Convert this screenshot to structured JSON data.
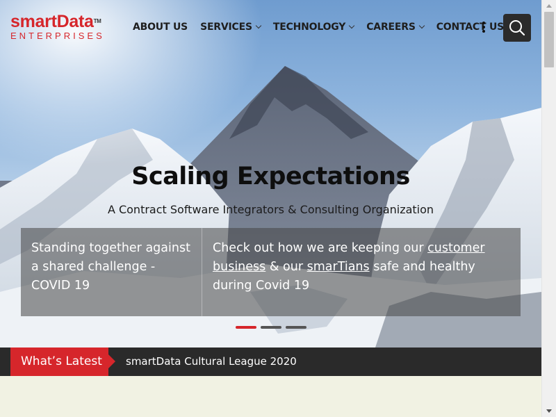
{
  "header": {
    "logo": {
      "main": "smartData",
      "tm": "TM",
      "sub": "ENTERPRISES"
    },
    "nav": [
      {
        "label": "ABOUT US",
        "dropdown": false
      },
      {
        "label": "SERVICES",
        "dropdown": true
      },
      {
        "label": "TECHNOLOGY",
        "dropdown": true
      },
      {
        "label": "CAREERS",
        "dropdown": true
      },
      {
        "label": "CONTACT US",
        "dropdown": false
      }
    ],
    "menu_icon": "kebab-menu-icon",
    "search_icon": "search-icon"
  },
  "hero": {
    "title": "Scaling Expectations",
    "subtitle": "A Contract Software Integrators & Consulting Organization",
    "left_text": "Standing together against a shared challenge - COVID 19",
    "right_text": {
      "part1": "Check out how we are keeping our ",
      "link1": "customer business",
      "part2": " & our ",
      "link2": "smarTians",
      "part3": " safe and healthy during Covid 19"
    },
    "slides_count": 3,
    "active_slide": 1
  },
  "latest": {
    "tag": "What’s Latest",
    "headline": "smartData Cultural League 2020"
  },
  "colors": {
    "brand_red": "#d6262b",
    "dark": "#2a2a2a",
    "cream": "#f1f2e3"
  }
}
